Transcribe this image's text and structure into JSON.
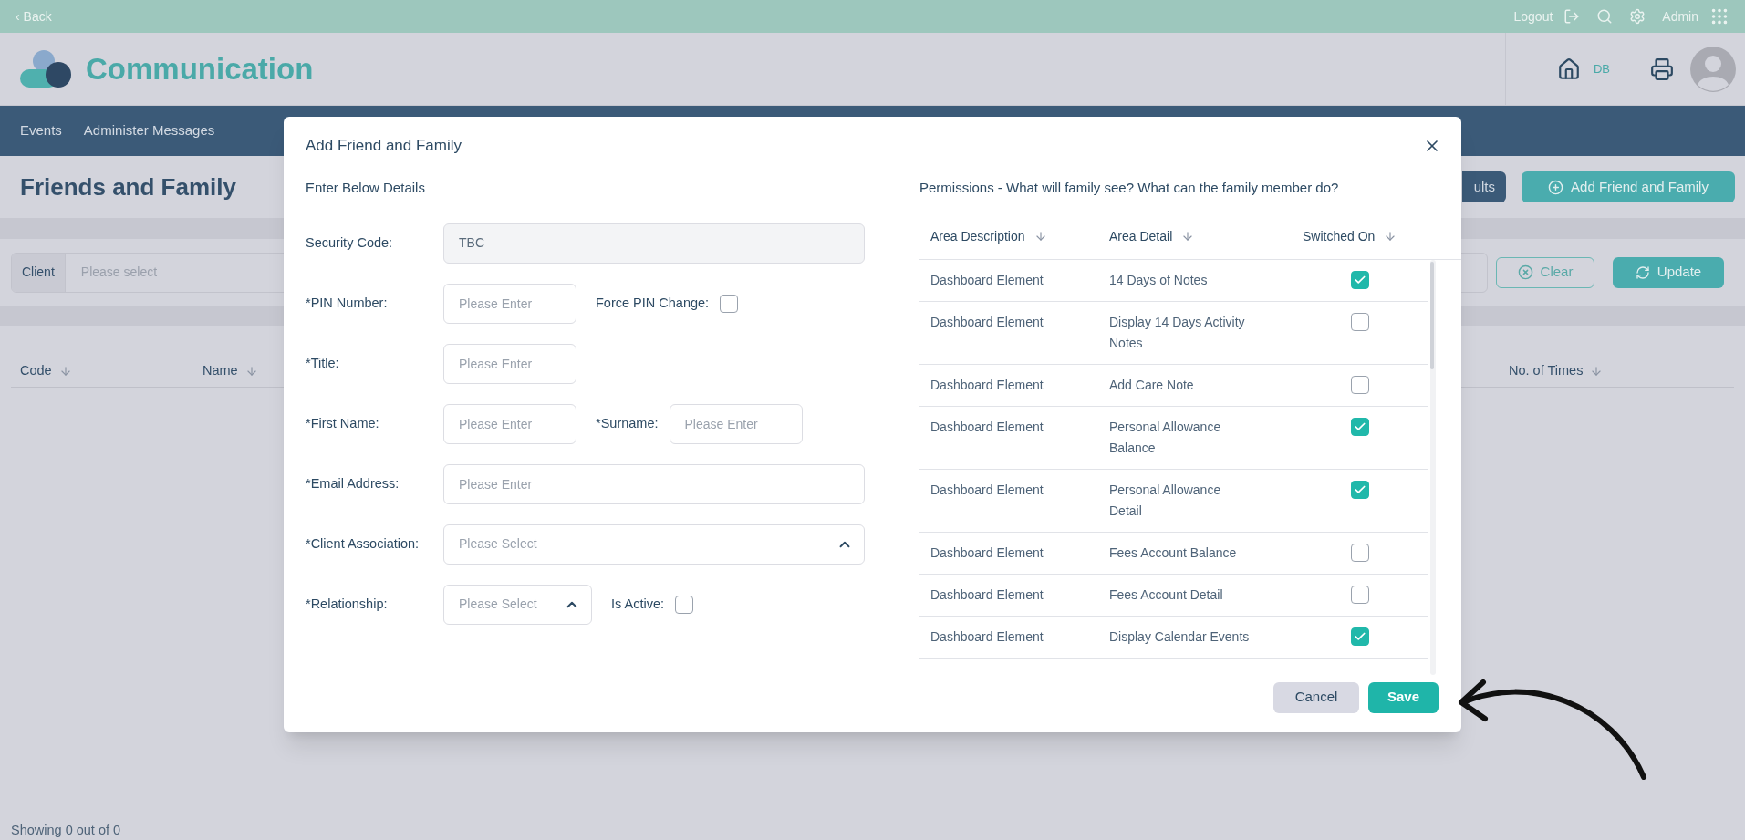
{
  "top_bar": {
    "back": "‹ Back",
    "logout": "Logout",
    "user": "Admin"
  },
  "header": {
    "app_title": "Communication",
    "home_badge": "DB"
  },
  "nav": {
    "items": [
      "Events",
      "Administer Messages"
    ]
  },
  "page": {
    "title": "Friends and Family",
    "buttons": [
      {
        "label": "ults",
        "kind": "dark"
      },
      {
        "label": "Add Friend and Family",
        "kind": "add"
      }
    ],
    "filter": {
      "label": "Client",
      "placeholder": "Please select"
    },
    "filter_buttons": [
      {
        "label": "Clear",
        "kind": "clear"
      },
      {
        "label": "Update",
        "kind": "update"
      }
    ],
    "table": {
      "columns": [
        "Code",
        "Name",
        "No. of Times"
      ]
    },
    "footer": "Showing 0 out of 0"
  },
  "dialog": {
    "title": "Add Friend and Family",
    "form_heading": "Enter Below Details",
    "rows": [
      [
        {
          "kind": "readonly",
          "label": "Security Code:",
          "value": "TBC"
        }
      ],
      [
        {
          "kind": "text",
          "label": "*PIN Number:",
          "placeholder": "Please Enter"
        },
        {
          "kind": "checkbox",
          "label": "Force PIN Change:",
          "checked": false
        }
      ],
      [
        {
          "kind": "text",
          "label": "*Title:",
          "placeholder": "Please Enter"
        }
      ],
      [
        {
          "kind": "text",
          "label": "*First Name:",
          "placeholder": "Please Enter"
        },
        {
          "kind": "text",
          "label": "*Surname:",
          "placeholder": "Please Enter"
        }
      ],
      [
        {
          "kind": "wide-text",
          "label": "*Email Address:",
          "placeholder": "Please Enter"
        }
      ],
      [
        {
          "kind": "wide-select",
          "label": "*Client Association:",
          "placeholder": "Please Select"
        }
      ],
      [
        {
          "kind": "select",
          "label": "*Relationship:",
          "placeholder": "Please Select"
        },
        {
          "kind": "checkbox",
          "label": "Is Active:",
          "checked": false
        }
      ]
    ],
    "permissions_heading": "Permissions - What will family see? What can the family member do?",
    "columns": [
      "Area Description",
      "Area Detail",
      "Switched On"
    ],
    "permissions": [
      {
        "area": "Dashboard Element",
        "detail": "14 Days of Notes",
        "on": true
      },
      {
        "area": "Dashboard Element",
        "detail": "Display 14 Days Activity Notes",
        "on": false
      },
      {
        "area": "Dashboard Element",
        "detail": "Add Care Note",
        "on": false
      },
      {
        "area": "Dashboard Element",
        "detail": "Personal Allowance Balance",
        "on": true
      },
      {
        "area": "Dashboard Element",
        "detail": "Personal Allowance Detail",
        "on": true
      },
      {
        "area": "Dashboard Element",
        "detail": "Fees Account Balance",
        "on": false
      },
      {
        "area": "Dashboard Element",
        "detail": "Fees Account Detail",
        "on": false
      },
      {
        "area": "Dashboard Element",
        "detail": "Display Calendar Events",
        "on": true
      }
    ],
    "buttons": [
      {
        "label": "Cancel",
        "kind": "secondary"
      },
      {
        "label": "Save",
        "kind": "primary"
      }
    ]
  }
}
